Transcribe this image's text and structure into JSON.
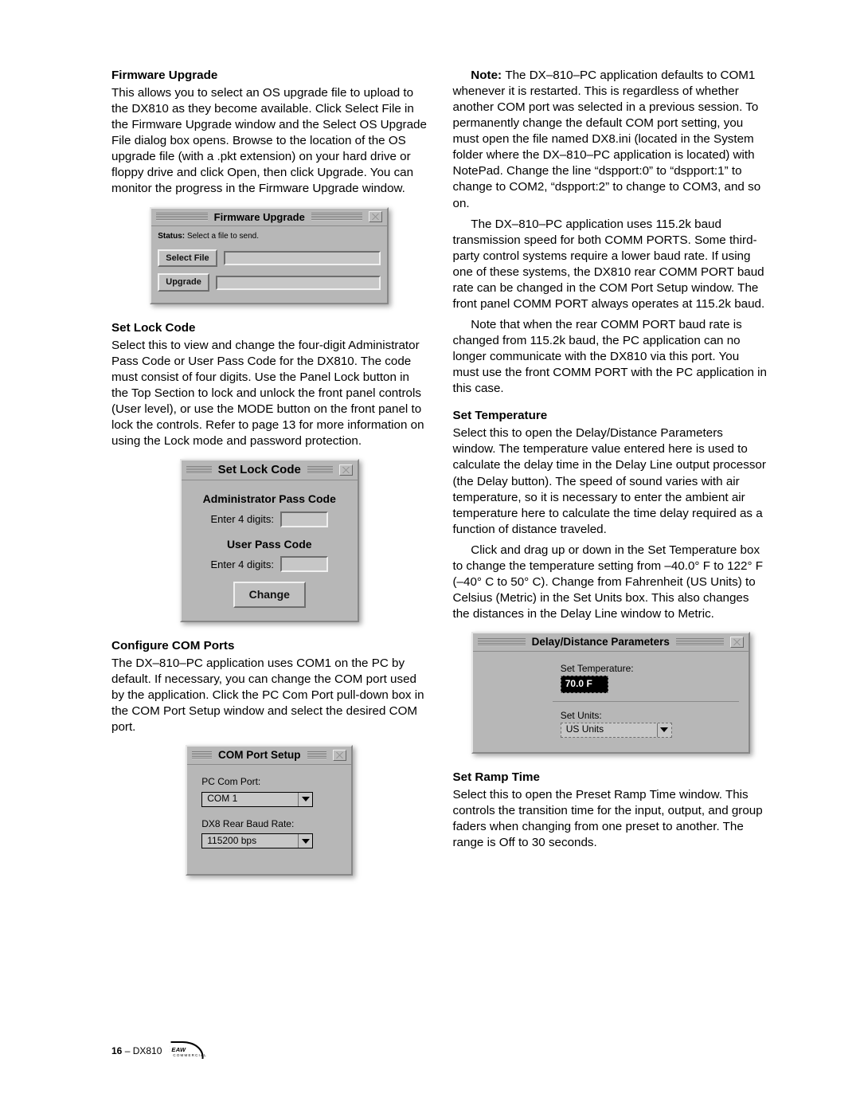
{
  "firmware": {
    "heading": "Firmware Upgrade",
    "p1": "This allows you to select an OS upgrade file to upload to the DX810 as they become available. Click Select File in the Firmware Upgrade window and the Select OS Upgrade File dialog box opens. Browse to the location of the OS upgrade file (with a .pkt extension) on your hard drive or floppy drive and click Open, then click Upgrade. You can monitor the progress in the Firmware Upgrade window.",
    "win": {
      "title": "Firmware Upgrade",
      "status_label": "Status:",
      "status_text": "Select a file to send.",
      "select_btn": "Select File",
      "upgrade_btn": "Upgrade"
    }
  },
  "lock": {
    "heading": "Set Lock Code",
    "p1": "Select this to view and change the four-digit Administrator Pass Code or User Pass Code for the DX810. The code must consist of four digits. Use the Panel Lock button in the Top Section to lock and unlock the front panel controls (User level), or use the MODE button on the front panel to lock the controls. Refer to page 13 for more information on using the Lock mode and password protection.",
    "win": {
      "title": "Set Lock Code",
      "admin_title": "Administrator Pass Code",
      "admin_label": "Enter 4 digits:",
      "user_title": "User Pass Code",
      "user_label": "Enter 4 digits:",
      "change_btn": "Change"
    }
  },
  "com": {
    "heading": "Configure COM Ports",
    "p1": "The DX–810–PC application uses COM1 on the PC by default. If necessary, you can change the COM port used by the application. Click the PC Com Port pull-down box in the COM Port Setup window and select the desired COM port.",
    "win": {
      "title": "COM Port Setup",
      "pc_label": "PC Com Port:",
      "pc_value": "COM 1",
      "baud_label": "DX8 Rear Baud Rate:",
      "baud_value": "115200 bps"
    }
  },
  "rightcol": {
    "note_label": "Note: ",
    "note_text": "The DX–810–PC application defaults to COM1 whenever it is restarted. This is regardless of whether another COM port was selected in a previous session. To permanently change the default COM port setting, you must open the file named DX8.ini (located in the System folder where the DX–810–PC application is located) with NotePad. Change the line “dspport:0” to “dspport:1” to change to COM2, “dspport:2” to change to COM3, and so on.",
    "baud_p": "The DX–810–PC application uses 115.2k baud transmission speed for both COMM PORTS. Some third-party control systems require a lower baud rate. If using one of these systems, the DX810 rear COMM PORT baud rate can be changed in the COM Port Setup window. The front panel COMM PORT always operates at 115.2k baud.",
    "baud_p2": "Note that when the rear COMM PORT baud rate is changed from 115.2k baud, the PC application can no longer communicate with the DX810 via this port. You must use the front COMM PORT with the PC application in this case."
  },
  "temp": {
    "heading": "Set Temperature",
    "p1": "Select this to open the Delay/Distance Parameters window. The temperature value entered here is used to calculate the delay time in the Delay Line output processor (the Delay button). The speed of sound varies with air temperature, so it is necessary to enter the ambient air temperature here to calculate the time delay required as a function of distance traveled.",
    "p2": "Click and drag up or down in the Set Temperature box to change the temperature setting from –40.0° F to 122° F (–40° C to 50° C). Change from Fahrenheit (US Units) to Celsius (Metric) in the Set Units box. This also changes the distances in the Delay Line window to Metric.",
    "win": {
      "title": "Delay/Distance Parameters",
      "temp_label": "Set Temperature:",
      "temp_value": "70.0 F",
      "units_label": "Set Units:",
      "units_value": "US Units"
    }
  },
  "ramp": {
    "heading": "Set Ramp Time",
    "p1": "Select this to open the Preset Ramp Time window. This controls the transition time for the input, output, and group faders when changing from one preset to another. The range is Off to 30 seconds."
  },
  "footer": {
    "page": "16",
    "dash": " – ",
    "model": "DX810",
    "brand": "EAW",
    "brand_sub": "COMMERCIAL"
  }
}
